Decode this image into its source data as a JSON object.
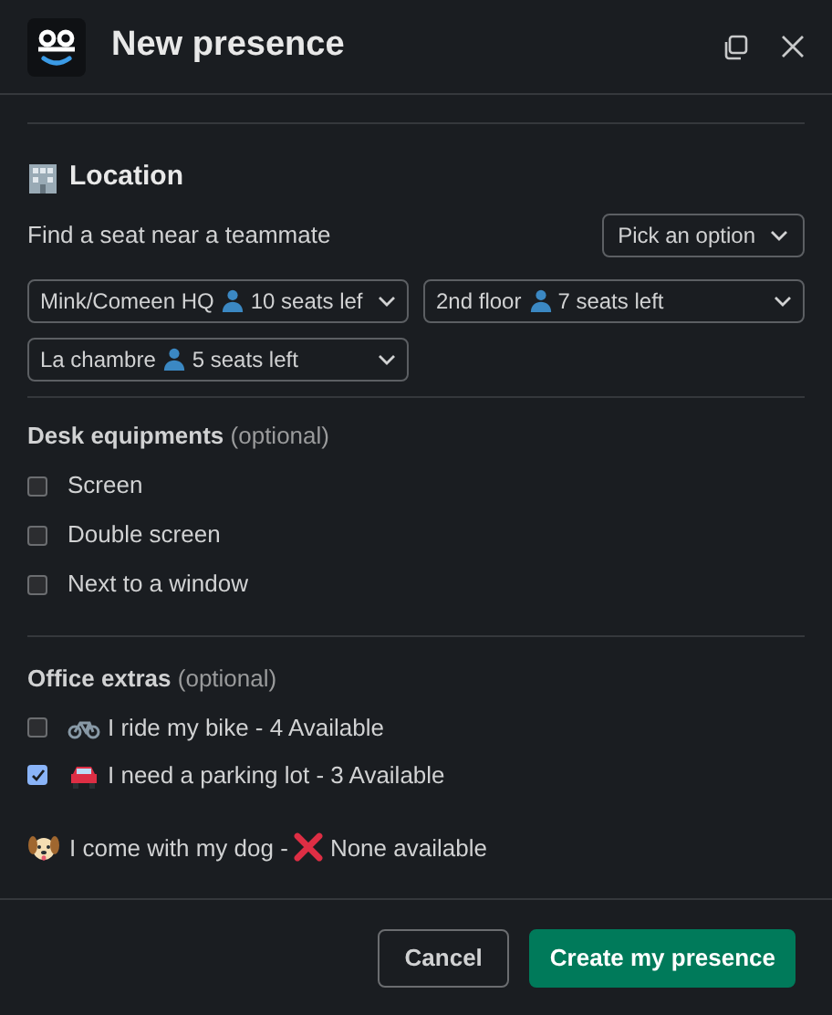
{
  "header": {
    "title": "New presence"
  },
  "location": {
    "title": "Location",
    "teammate_label": "Find a seat near a teammate",
    "teammate_select": {
      "placeholder": "Pick an option"
    },
    "selects": [
      {
        "place": "Mink/Comeen HQ",
        "seats": "10 seats lef"
      },
      {
        "place": "2nd floor",
        "seats": "7 seats left"
      },
      {
        "place": "La chambre",
        "seats": "5 seats left"
      }
    ]
  },
  "desk_equipments": {
    "title": "Desk equipments",
    "note": "(optional)",
    "options": [
      {
        "label": "Screen",
        "checked": false
      },
      {
        "label": "Double screen",
        "checked": false
      },
      {
        "label": "Next to a window",
        "checked": false
      }
    ]
  },
  "office_extras": {
    "title": "Office extras",
    "note": "(optional)",
    "options": [
      {
        "kind": "bike",
        "label": "I ride my bike - 4 Available",
        "checked": false
      },
      {
        "kind": "car",
        "label": "I need a parking lot - 3 Available",
        "checked": true
      }
    ],
    "unavailable": {
      "kind": "dog",
      "label": "I come with my dog -",
      "status": "None available"
    }
  },
  "buttons": [
    {
      "kind": "secondary",
      "label": "Cancel"
    },
    {
      "kind": "primary",
      "label": "Create my presence"
    }
  ]
}
